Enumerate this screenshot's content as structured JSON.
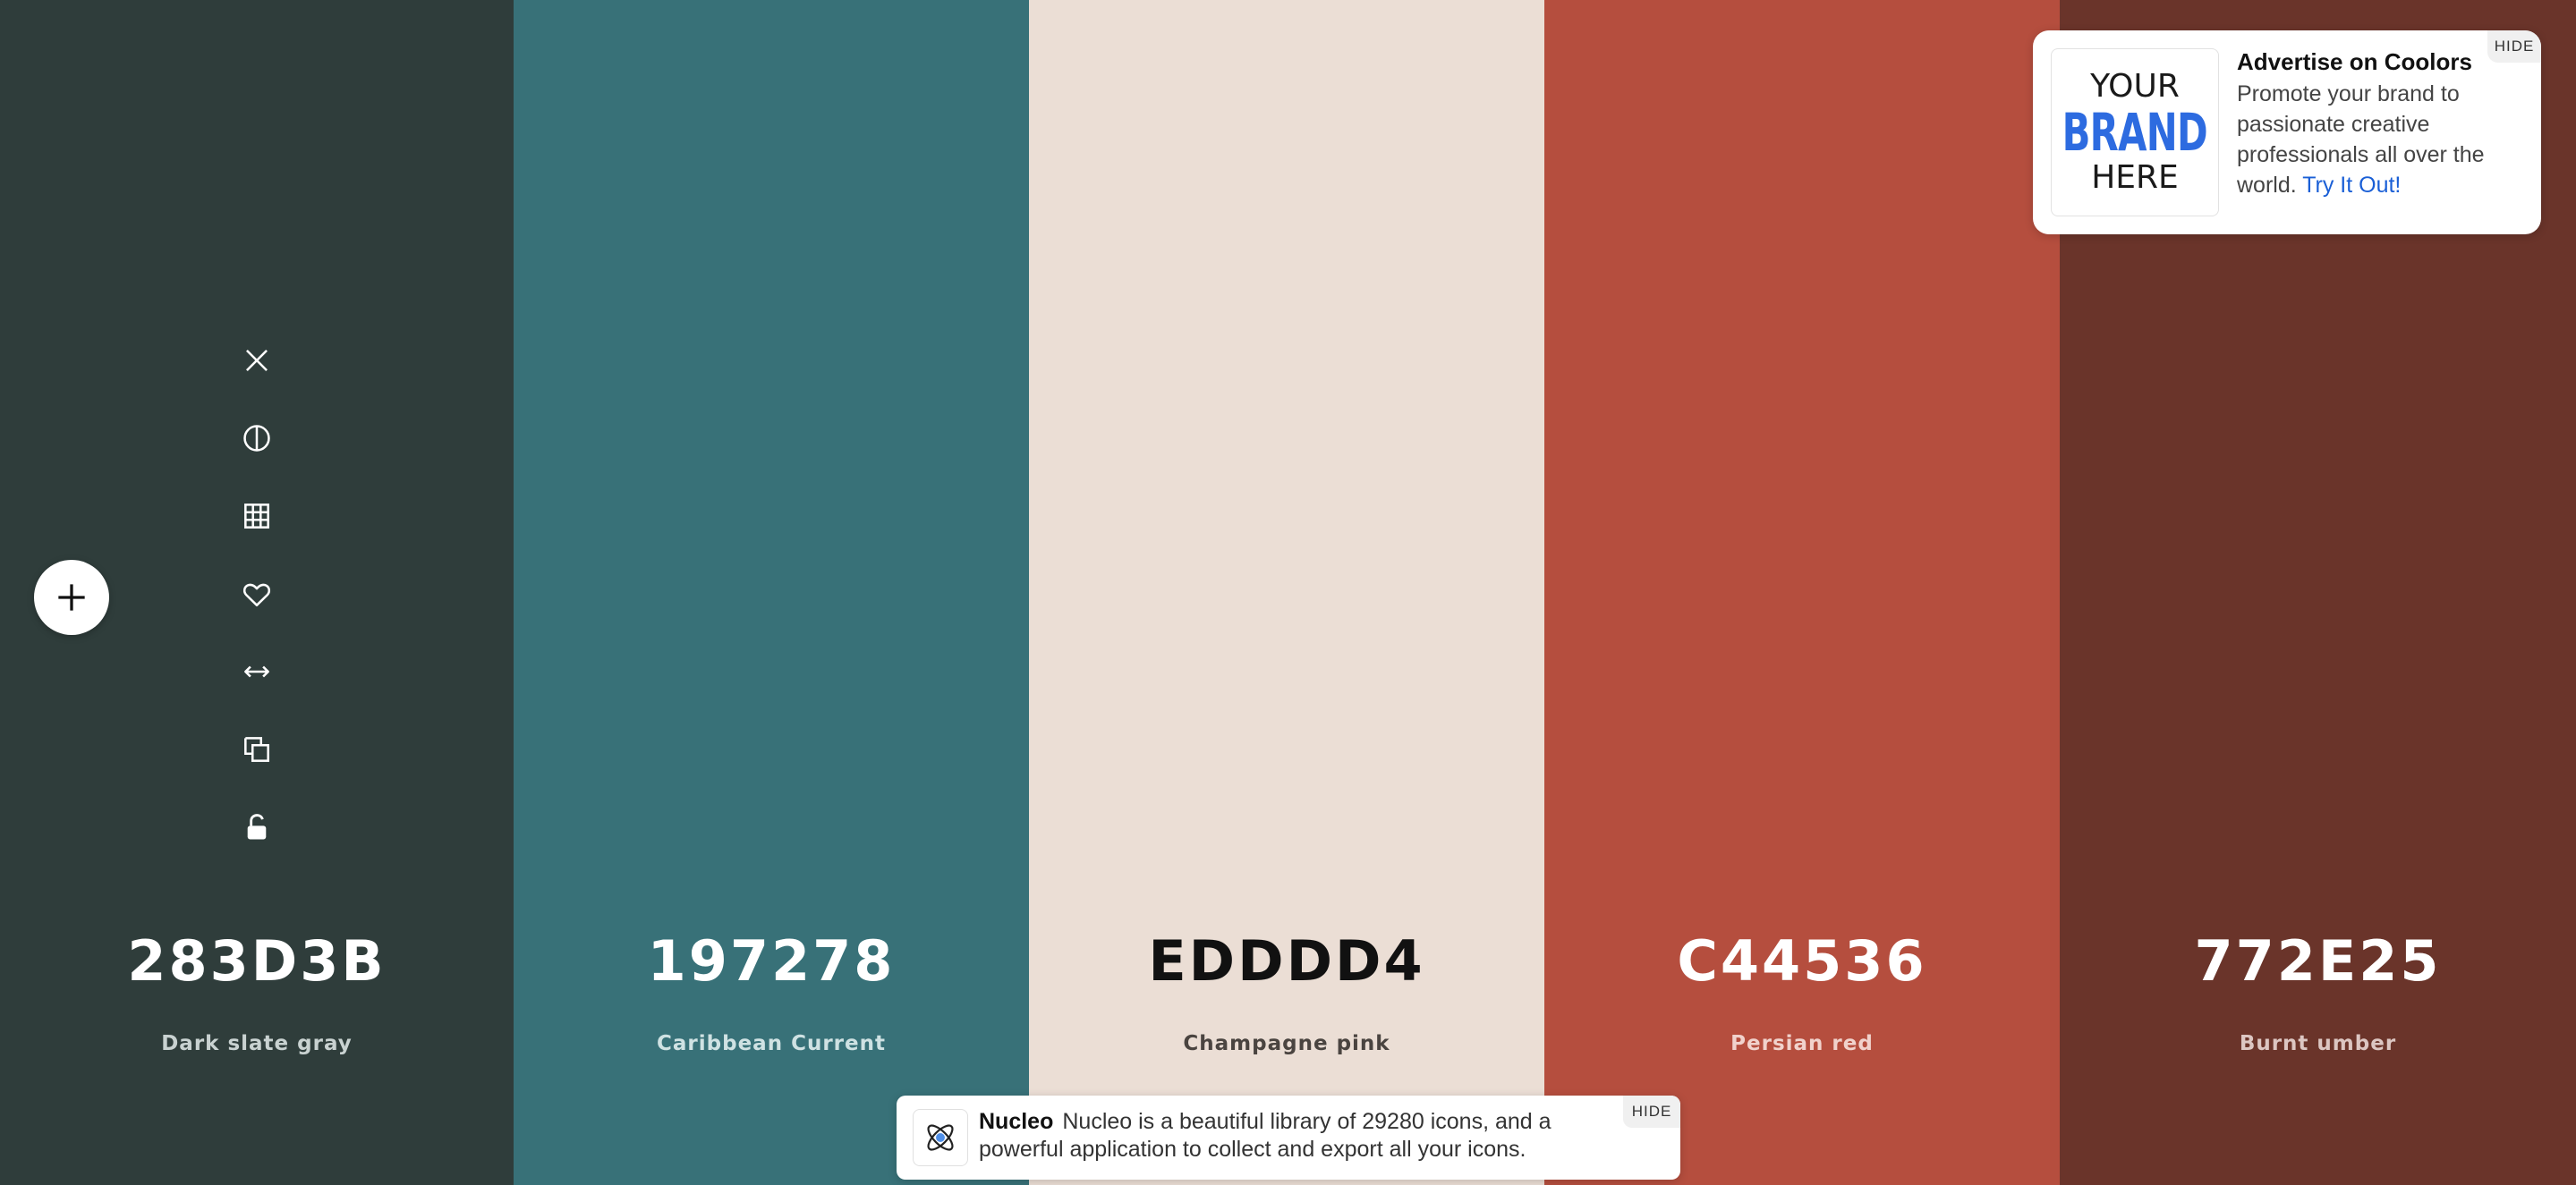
{
  "palette": [
    {
      "hex": "283D3B",
      "name": "Dark slate gray",
      "color": "#2f3d3b",
      "text_color": "#ffffff",
      "name_color": "#c9d2d1"
    },
    {
      "hex": "197278",
      "name": "Caribbean Current",
      "color": "#387178",
      "text_color": "#ffffff",
      "name_color": "#cfe2e3"
    },
    {
      "hex": "EDDDD4",
      "name": "Champagne pink",
      "color": "#ebded5",
      "text_color": "#111111",
      "name_color": "#4a4440"
    },
    {
      "hex": "C44536",
      "name": "Persian red",
      "color": "#b54e3e",
      "text_color": "#ffffff",
      "name_color": "#f1d2cc"
    },
    {
      "hex": "772E25",
      "name": "Burnt umber",
      "color": "#6a342a",
      "text_color": "#ffffff",
      "name_color": "#dcc6c2"
    }
  ],
  "tools": [
    {
      "name": "close-icon"
    },
    {
      "name": "contrast-icon"
    },
    {
      "name": "grid-icon"
    },
    {
      "name": "heart-icon"
    },
    {
      "name": "drag-horizontal-icon"
    },
    {
      "name": "copy-icon"
    },
    {
      "name": "unlock-icon"
    }
  ],
  "add_button": {
    "icon": "plus-icon"
  },
  "ad": {
    "hide_label": "HIDE",
    "logo_your": "YOUR",
    "logo_brand": "BRAND",
    "logo_here": "HERE",
    "title": "Advertise on Coolors",
    "body": "Promote your brand to passionate creative professionals all over the world.",
    "link": "Try It Out!"
  },
  "promo": {
    "hide_label": "HIDE",
    "name": "Nucleo",
    "text": "Nucleo is a beautiful library of 29280 icons, and a powerful application to collect and export all your icons.",
    "logo_icon": "atom-icon"
  }
}
